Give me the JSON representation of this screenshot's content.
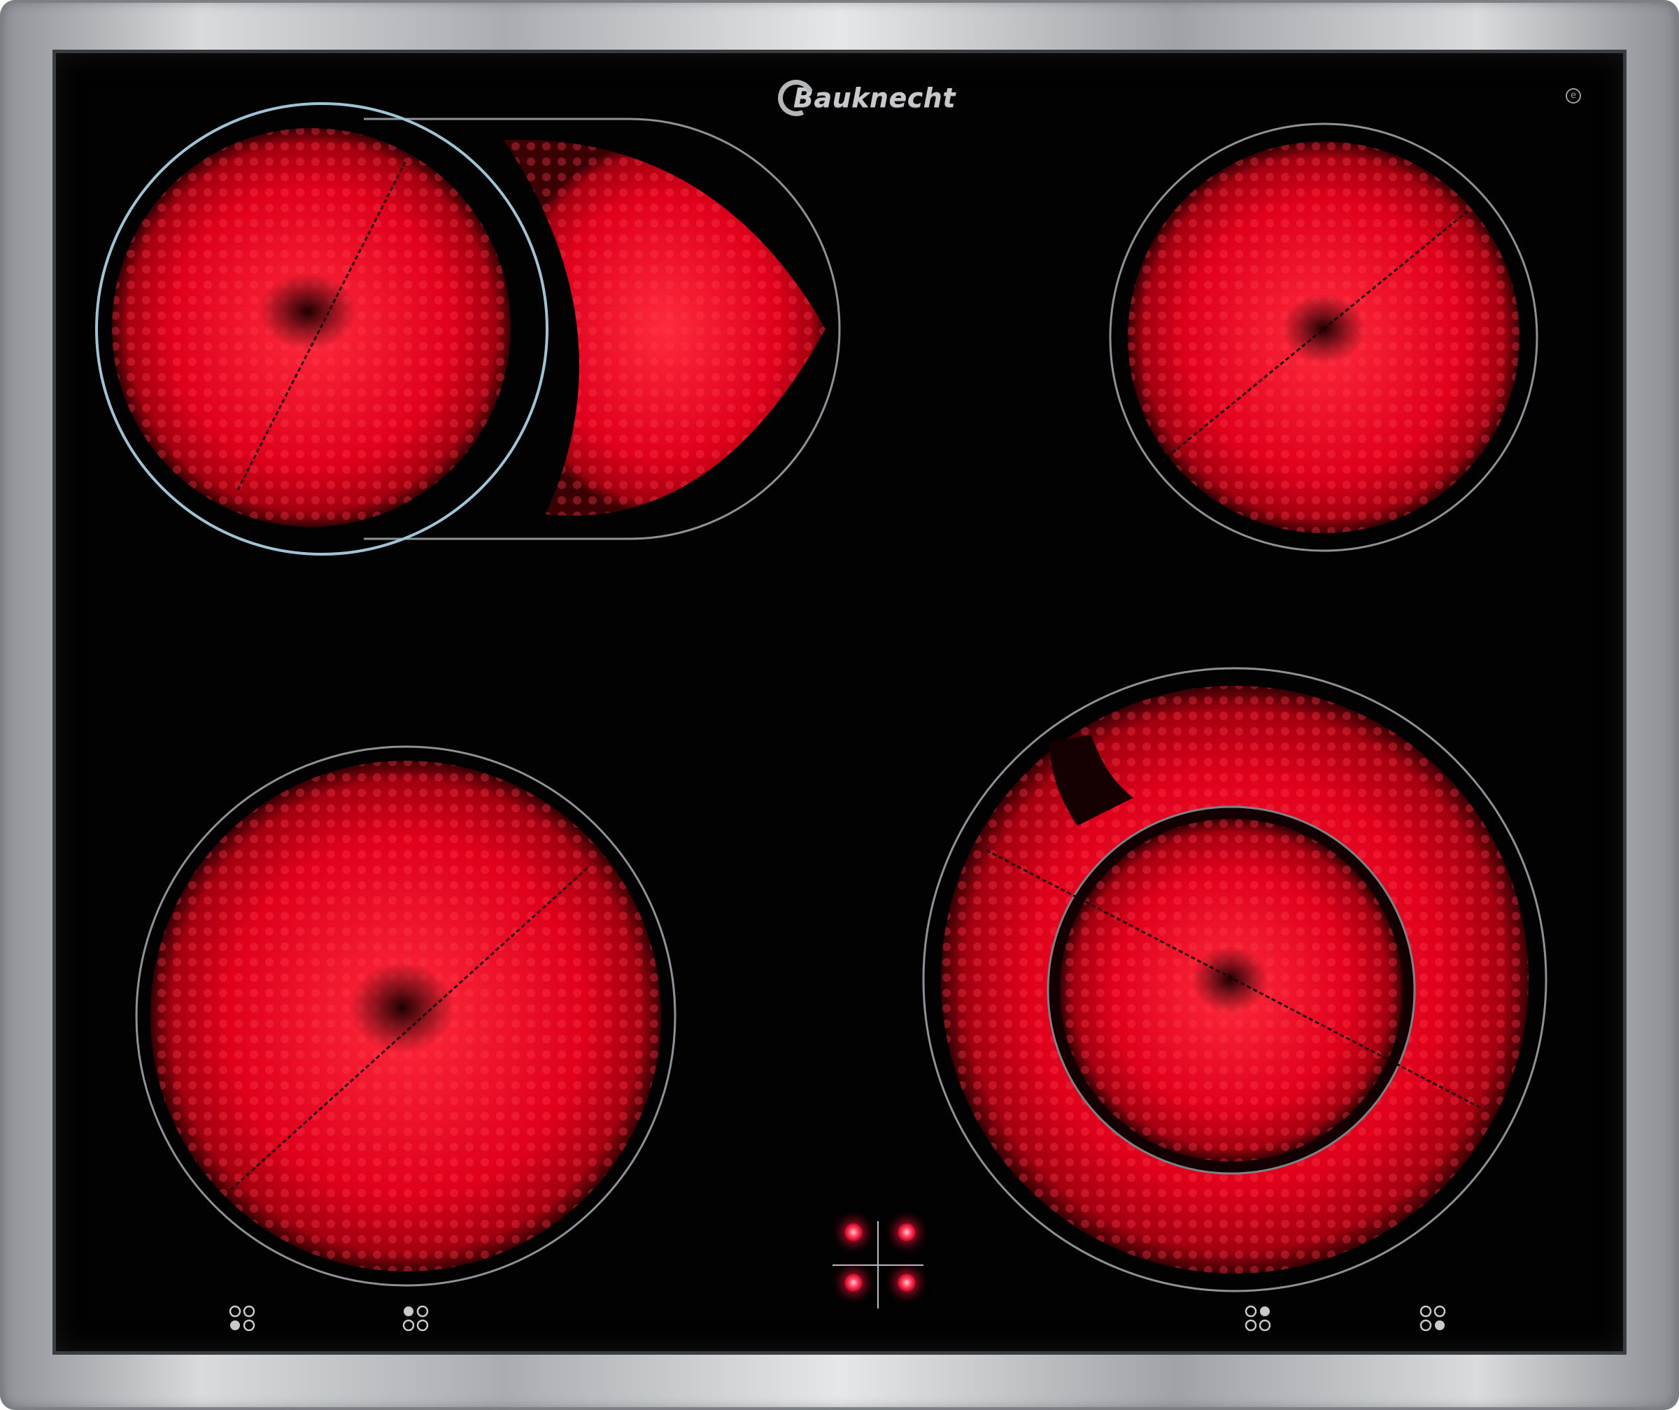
{
  "brand": {
    "name": "Bauknecht"
  },
  "appliance": {
    "type": "ceramic cooktop",
    "frame_color": "#b9bcbf",
    "glass_color": "#020202",
    "glow_color": "#e6001e"
  },
  "cooking_zones": [
    {
      "id": "front-left",
      "shape": "round",
      "state": "on"
    },
    {
      "id": "rear-left-oval",
      "shape": "dual oval extension",
      "state": "on"
    },
    {
      "id": "rear-right",
      "shape": "round",
      "state": "on"
    },
    {
      "id": "front-right",
      "shape": "dual ring",
      "state": "on"
    }
  ],
  "residual_heat_indicators": {
    "count": 4,
    "color": "#ff2a4a",
    "state": "lit"
  },
  "icons": {
    "logo": "bauknecht-logo",
    "energy": "energy-mark-icon",
    "zone_symbol": "zone-position-icon"
  }
}
